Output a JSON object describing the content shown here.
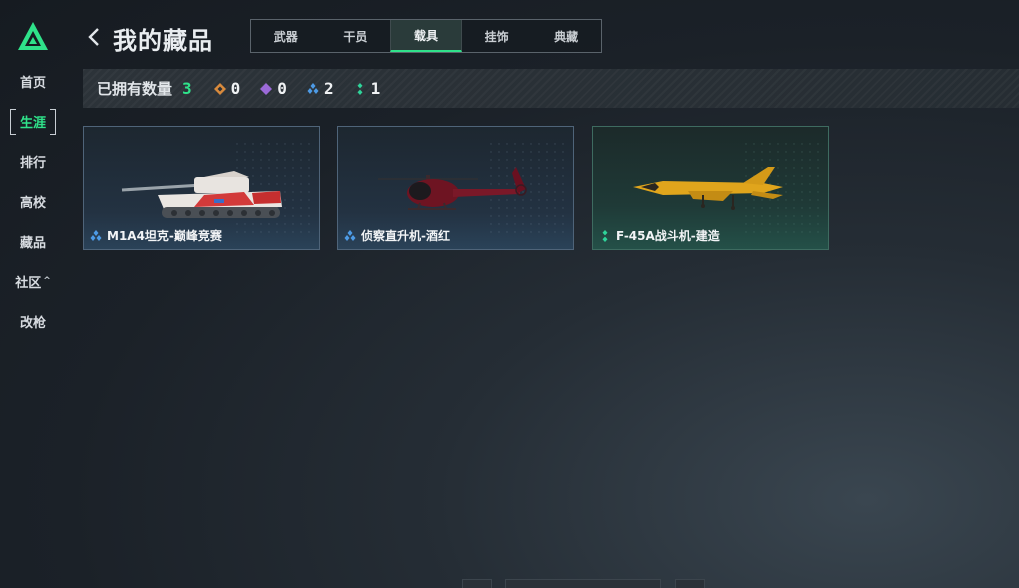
{
  "nav": {
    "items": [
      {
        "label": "首页"
      },
      {
        "label": "生涯"
      },
      {
        "label": "排行"
      },
      {
        "label": "高校"
      },
      {
        "label": "藏品"
      },
      {
        "label": "社区"
      },
      {
        "label": "改枪"
      }
    ],
    "active_index": 1
  },
  "header": {
    "title": "我的藏品",
    "tabs": [
      {
        "label": "武器"
      },
      {
        "label": "干员"
      },
      {
        "label": "载具"
      },
      {
        "label": "挂饰"
      },
      {
        "label": "典藏"
      }
    ],
    "active_tab": 2
  },
  "stats": {
    "label": "已拥有数量",
    "total": "3",
    "rarities": [
      {
        "icon": "orange-diamond-icon",
        "color": "#d98a3c",
        "count": "0"
      },
      {
        "icon": "purple-diamond-icon",
        "color": "#9b6ad8",
        "count": "0"
      },
      {
        "icon": "blue-triple-diamond-icon",
        "color": "#4d9be6",
        "count": "2"
      },
      {
        "icon": "green-double-diamond-icon",
        "color": "#2fd49a",
        "count": "1"
      }
    ]
  },
  "cards": [
    {
      "name": "M1A4坦克-巅峰竞赛",
      "rarity": "blue",
      "image": "tank"
    },
    {
      "name": "侦察直升机-酒红",
      "rarity": "blue",
      "image": "helicopter"
    },
    {
      "name": "F-45A战斗机-建造",
      "rarity": "green",
      "image": "jet"
    }
  ],
  "colors": {
    "accent": "#2fe28a",
    "rarity_blue": "#4d9be6",
    "rarity_green": "#2fd49a"
  }
}
